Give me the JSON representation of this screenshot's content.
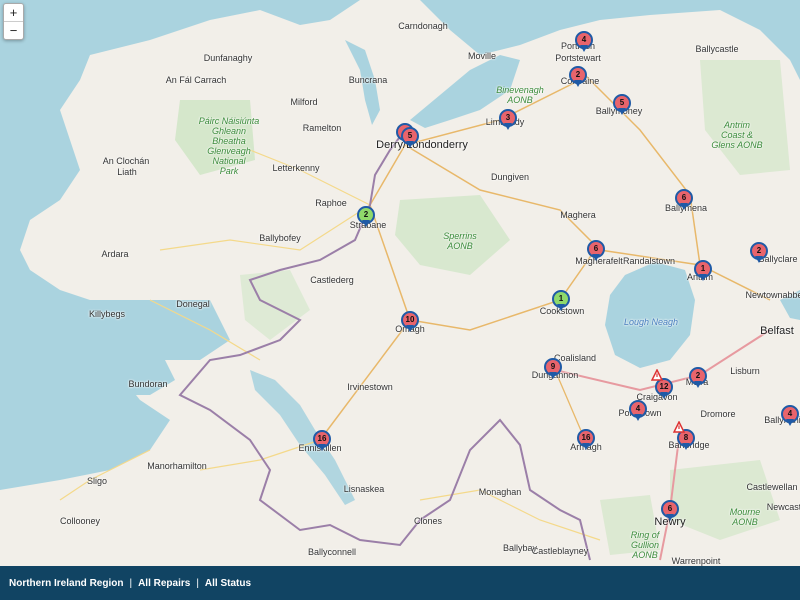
{
  "zoom": {
    "in_label": "+",
    "out_label": "−"
  },
  "places": [
    {
      "id": "carndonagh",
      "text": "Carndonagh"
    },
    {
      "id": "dunfanaghy",
      "text": "Dunfanaghy"
    },
    {
      "id": "anfalcarrach",
      "text": "An Fál Carrach"
    },
    {
      "id": "milford",
      "text": "Milford"
    },
    {
      "id": "buncrana",
      "text": "Buncrana"
    },
    {
      "id": "moville",
      "text": "Moville"
    },
    {
      "id": "ramelton",
      "text": "Ramelton"
    },
    {
      "id": "letterkenny",
      "text": "Letterkenny"
    },
    {
      "id": "anclochan",
      "text": "An Clochán"
    },
    {
      "id": "liath",
      "text": "Liath"
    },
    {
      "id": "raphoe",
      "text": "Raphoe"
    },
    {
      "id": "ballybofey",
      "text": "Ballybofey"
    },
    {
      "id": "ardara",
      "text": "Ardara"
    },
    {
      "id": "donegal",
      "text": "Donegal"
    },
    {
      "id": "killybegs",
      "text": "Killybegs"
    },
    {
      "id": "bundoran",
      "text": "Bundoran"
    },
    {
      "id": "castlederg",
      "text": "Castlederg"
    },
    {
      "id": "irvinestown",
      "text": "Irvinestown"
    },
    {
      "id": "manorhamilton",
      "text": "Manorhamilton"
    },
    {
      "id": "sligo",
      "text": "Sligo"
    },
    {
      "id": "collooney",
      "text": "Collooney"
    },
    {
      "id": "lisnaskea",
      "text": "Lisnaskea"
    },
    {
      "id": "ballyconnell",
      "text": "Ballyconnell"
    },
    {
      "id": "clones",
      "text": "Clones"
    },
    {
      "id": "monaghan",
      "text": "Monaghan"
    },
    {
      "id": "ballybay",
      "text": "Ballybay"
    },
    {
      "id": "castleblayney",
      "text": "Castleblayney"
    },
    {
      "id": "warrenpoint",
      "text": "Warrenpoint"
    },
    {
      "id": "castlewellan",
      "text": "Castlewellan"
    },
    {
      "id": "newcastle",
      "text": "Newcastl"
    },
    {
      "id": "ballynahinch",
      "text": "Ballynahin"
    },
    {
      "id": "dromore",
      "text": "Dromore"
    },
    {
      "id": "lisburn",
      "text": "Lisburn"
    },
    {
      "id": "belfast",
      "text": "Belfast"
    },
    {
      "id": "newtownabbey",
      "text": "Newtownabbe"
    },
    {
      "id": "randalstown",
      "text": "Randalstown"
    },
    {
      "id": "ballyclare",
      "text": "Ballyclare"
    },
    {
      "id": "ballycastle",
      "text": "Ballycastle"
    },
    {
      "id": "portstewart",
      "text": "Portstewart"
    },
    {
      "id": "portrush",
      "text": "Portrush"
    },
    {
      "id": "coleraine",
      "text": "Coleraine"
    },
    {
      "id": "ballymoney",
      "text": "Ballymoney"
    },
    {
      "id": "limavady",
      "text": "Limavady"
    },
    {
      "id": "derry",
      "text": "Derry/Londonderry"
    },
    {
      "id": "dungiven",
      "text": "Dungiven"
    },
    {
      "id": "maghera",
      "text": "Maghera"
    },
    {
      "id": "magherafelt",
      "text": "Magherafelt"
    },
    {
      "id": "ballymena",
      "text": "Ballymena"
    },
    {
      "id": "antrim",
      "text": "Antrim"
    },
    {
      "id": "cookstown",
      "text": "Cookstown"
    },
    {
      "id": "omagh",
      "text": "Omagh"
    },
    {
      "id": "strabane",
      "text": "Strabane"
    },
    {
      "id": "dungannon",
      "text": "Dungannon"
    },
    {
      "id": "coalisland",
      "text": "Coalisland"
    },
    {
      "id": "craigavon",
      "text": "Craigavon"
    },
    {
      "id": "portadown",
      "text": "Portadown"
    },
    {
      "id": "moira",
      "text": "Moira"
    },
    {
      "id": "banbridge",
      "text": "Banbridge"
    },
    {
      "id": "armagh",
      "text": "Armagh"
    },
    {
      "id": "newry",
      "text": "Newry"
    },
    {
      "id": "enniskillen",
      "text": "Enniskillen"
    },
    {
      "id": "loughneagh",
      "text": "Lough Neagh"
    },
    {
      "id": "sperrins",
      "text": "Sperrins\nAONB"
    },
    {
      "id": "binevenagh",
      "text": "Binevenagh\nAONB"
    },
    {
      "id": "antrimcoast",
      "text": "Antrim\nCoast &\nGlens AONB"
    },
    {
      "id": "glenveagh",
      "text": "Páirc Náisiúnta\nGhleann\nBheatha\nGlenveagh\nNational\nPark"
    },
    {
      "id": "mourne",
      "text": "Mourne\nAONB"
    },
    {
      "id": "ringofgullion",
      "text": "Ring of\nGullion\nAONB"
    }
  ],
  "markers": [
    {
      "id": "portrush",
      "label": "4",
      "color": "red"
    },
    {
      "id": "coleraine",
      "label": "2",
      "color": "red"
    },
    {
      "id": "ballymoney",
      "label": "5",
      "color": "red"
    },
    {
      "id": "limavady",
      "label": "3",
      "color": "red"
    },
    {
      "id": "derry-a",
      "label": "",
      "color": "red"
    },
    {
      "id": "derry-b",
      "label": "5",
      "color": "red"
    },
    {
      "id": "strabane",
      "label": "2",
      "color": "green"
    },
    {
      "id": "ballymena",
      "label": "6",
      "color": "red"
    },
    {
      "id": "magherafelt",
      "label": "6",
      "color": "red"
    },
    {
      "id": "ballyclare",
      "label": "2",
      "color": "red"
    },
    {
      "id": "antrim",
      "label": "1",
      "color": "red"
    },
    {
      "id": "cookstown",
      "label": "1",
      "color": "green"
    },
    {
      "id": "omagh",
      "label": "10",
      "color": "red"
    },
    {
      "id": "dungannon",
      "label": "9",
      "color": "red"
    },
    {
      "id": "craigavon",
      "label": "12",
      "color": "red"
    },
    {
      "id": "moira",
      "label": "2",
      "color": "red"
    },
    {
      "id": "portadown",
      "label": "4",
      "color": "red"
    },
    {
      "id": "banbridge",
      "label": "8",
      "color": "red"
    },
    {
      "id": "armagh",
      "label": "16",
      "color": "red"
    },
    {
      "id": "enniskillen",
      "label": "16",
      "color": "red"
    },
    {
      "id": "newry",
      "label": "6",
      "color": "red"
    },
    {
      "id": "ballynahinch",
      "label": "4",
      "color": "red"
    }
  ],
  "footer": {
    "region": "Northern Ireland Region",
    "sep1": "|",
    "repairs": "All Repairs",
    "sep2": "|",
    "status": "All Status"
  }
}
